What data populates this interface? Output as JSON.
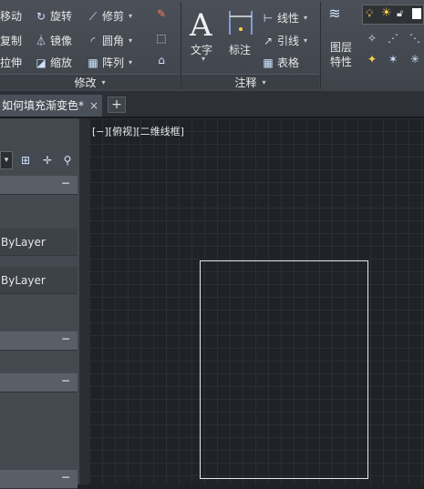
{
  "ribbon": {
    "modify": {
      "move": "移动",
      "rotate": "旋转",
      "trim": "修剪",
      "copy": "复制",
      "mirror": "镜像",
      "fillet": "圆角",
      "stretch": "拉伸",
      "scale": "缩放",
      "array": "阵列",
      "panel_title": "修改"
    },
    "annotation": {
      "text": "文字",
      "dimension": "标注",
      "linear": "线性",
      "leader": "引线",
      "table": "表格",
      "panel_title": "注释"
    },
    "layers": {
      "layer_properties": "图层\n特性"
    }
  },
  "tabs": {
    "drawing_tab": "如何填充渐变色*",
    "close": "×",
    "new": "+"
  },
  "properties": {
    "rows": [
      {
        "value": "ByLayer"
      },
      {
        "value": "ByLayer"
      }
    ],
    "collapse": "−"
  },
  "viewport": {
    "label": "[−][俯视][二维线框]"
  },
  "colors": {
    "ribbon": "#474c53",
    "canvas": "#1f2227",
    "accent": "#ffd24a"
  }
}
